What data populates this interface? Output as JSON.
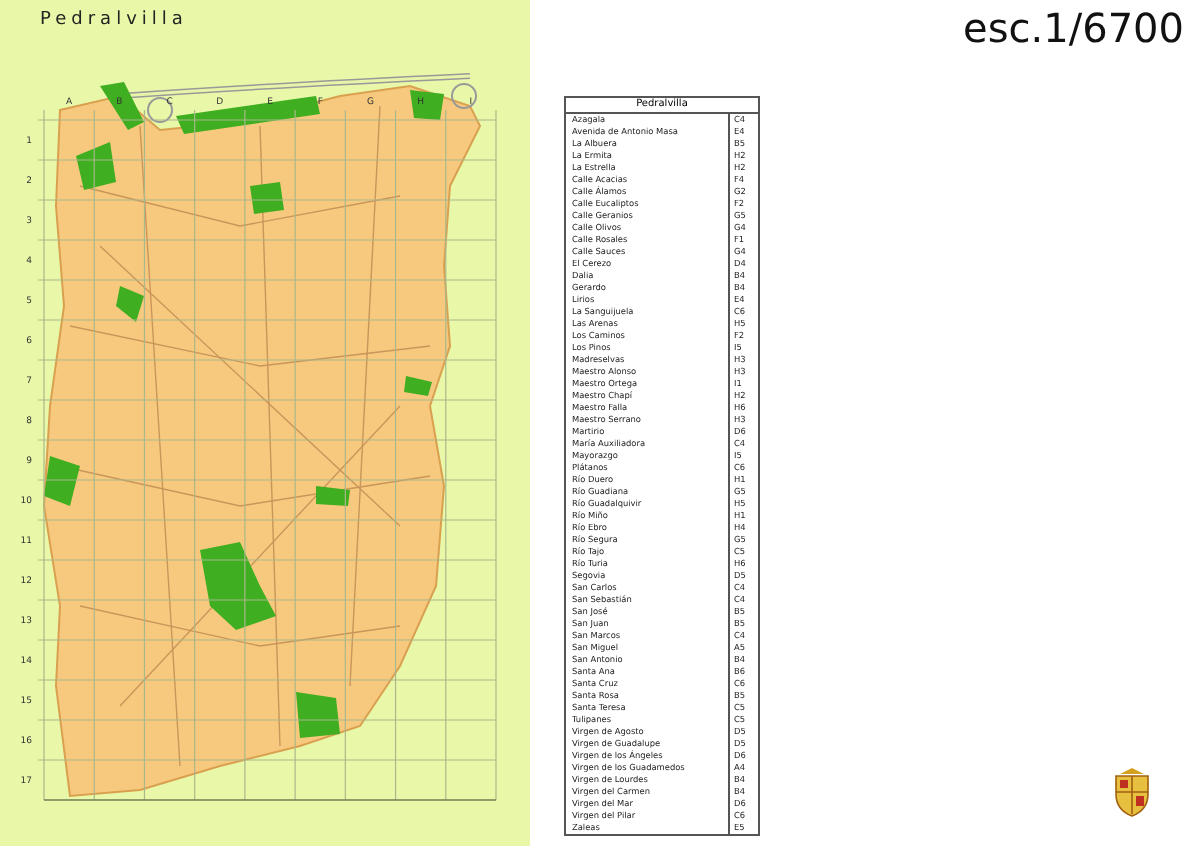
{
  "map": {
    "title": "Pedralvilla",
    "column_labels": [
      "A",
      "B",
      "C",
      "D",
      "E",
      "F",
      "G",
      "H",
      "I"
    ],
    "row_labels": [
      "1",
      "2",
      "3",
      "4",
      "5",
      "6",
      "7",
      "8",
      "9",
      "10",
      "11",
      "12",
      "13",
      "14",
      "15",
      "16",
      "17"
    ]
  },
  "scale": "esc.1/6700",
  "street_index": {
    "title": "Pedralvilla",
    "entries": [
      {
        "name": "Azagala",
        "code": "C4"
      },
      {
        "name": "Avenida de Antonio Masa",
        "code": "E4"
      },
      {
        "name": "La Albuera",
        "code": "B5"
      },
      {
        "name": "La Ermita",
        "code": "H2"
      },
      {
        "name": "La Estrella",
        "code": "H2"
      },
      {
        "name": "Calle Acacias",
        "code": "F4"
      },
      {
        "name": "Calle Álamos",
        "code": "G2"
      },
      {
        "name": "Calle Eucaliptos",
        "code": "F2"
      },
      {
        "name": "Calle Geranios",
        "code": "G5"
      },
      {
        "name": "Calle Olivos",
        "code": "G4"
      },
      {
        "name": "Calle Rosales",
        "code": "F1"
      },
      {
        "name": "Calle Sauces",
        "code": "G4"
      },
      {
        "name": "El Cerezo",
        "code": "D4"
      },
      {
        "name": "Dalia",
        "code": "B4"
      },
      {
        "name": "Gerardo",
        "code": "B4"
      },
      {
        "name": "Lirios",
        "code": "E4"
      },
      {
        "name": "La Sanguijuela",
        "code": "C6"
      },
      {
        "name": "Las Arenas",
        "code": "H5"
      },
      {
        "name": "Los Caminos",
        "code": "F2"
      },
      {
        "name": "Los Pinos",
        "code": "I5"
      },
      {
        "name": "Madreselvas",
        "code": "H3"
      },
      {
        "name": "Maestro Alonso",
        "code": "H3"
      },
      {
        "name": "Maestro Ortega",
        "code": "I1"
      },
      {
        "name": "Maestro Chapí",
        "code": "H2"
      },
      {
        "name": "Maestro Falla",
        "code": "H6"
      },
      {
        "name": "Maestro Serrano",
        "code": "H3"
      },
      {
        "name": "Martirio",
        "code": "D6"
      },
      {
        "name": "María Auxiliadora",
        "code": "C4"
      },
      {
        "name": "Mayorazgo",
        "code": "I5"
      },
      {
        "name": "Plátanos",
        "code": "C6"
      },
      {
        "name": "Río Duero",
        "code": "H1"
      },
      {
        "name": "Río Guadiana",
        "code": "G5"
      },
      {
        "name": "Río Guadalquivir",
        "code": "H5"
      },
      {
        "name": "Río Miño",
        "code": "H1"
      },
      {
        "name": "Río Ebro",
        "code": "H4"
      },
      {
        "name": "Río Segura",
        "code": "G5"
      },
      {
        "name": "Río Tajo",
        "code": "C5"
      },
      {
        "name": "Río Turia",
        "code": "H6"
      },
      {
        "name": "Segovia",
        "code": "D5"
      },
      {
        "name": "San Carlos",
        "code": "C4"
      },
      {
        "name": "San Sebastián",
        "code": "C4"
      },
      {
        "name": "San José",
        "code": "B5"
      },
      {
        "name": "San Juan",
        "code": "B5"
      },
      {
        "name": "San Marcos",
        "code": "C4"
      },
      {
        "name": "San Miguel",
        "code": "A5"
      },
      {
        "name": "San Antonio",
        "code": "B4"
      },
      {
        "name": "Santa Ana",
        "code": "B6"
      },
      {
        "name": "Santa Cruz",
        "code": "C6"
      },
      {
        "name": "Santa Rosa",
        "code": "B5"
      },
      {
        "name": "Santa Teresa",
        "code": "C5"
      },
      {
        "name": "Tulipanes",
        "code": "C5"
      },
      {
        "name": "Virgen de Agosto",
        "code": "D5"
      },
      {
        "name": "Virgen de Guadalupe",
        "code": "D5"
      },
      {
        "name": "Virgen de los Ángeles",
        "code": "D6"
      },
      {
        "name": "Virgen de los Guadamedos",
        "code": "A4"
      },
      {
        "name": "Virgen de Lourdes",
        "code": "B4"
      },
      {
        "name": "Virgen del Carmen",
        "code": "B4"
      },
      {
        "name": "Virgen del Mar",
        "code": "D6"
      },
      {
        "name": "Virgen del Pilar",
        "code": "C6"
      },
      {
        "name": "Zaleas",
        "code": "E5"
      }
    ]
  }
}
